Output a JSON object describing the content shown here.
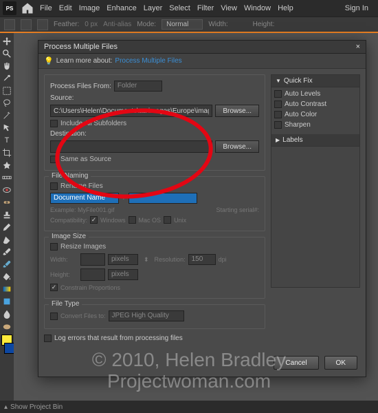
{
  "menubar": {
    "items": [
      "File",
      "Edit",
      "Image",
      "Enhance",
      "Layer",
      "Select",
      "Filter",
      "View",
      "Window",
      "Help"
    ],
    "signin": "Sign In"
  },
  "optionsbar": {
    "feather": "Feather:",
    "feather_val": "0 px",
    "antialias": "Anti-alias",
    "mode": "Mode:",
    "mode_val": "Normal",
    "width": "Width:",
    "height": "Height:"
  },
  "dialog": {
    "title": "Process Multiple Files",
    "learn_more": "Learn more about:",
    "learn_link": "Process Multiple Files",
    "process_from": "Process Files From:",
    "process_from_val": "Folder",
    "source": "Source:",
    "source_val": "C:\\Users\\Helen\\Documents\\aa images\\Europe\\images fo",
    "browse": "Browse...",
    "include_sub": "Include All Subfolders",
    "destination": "Destination:",
    "same_as": "Same as Source",
    "file_naming": "File Naming",
    "rename": "Rename Files",
    "token1": "Document Name",
    "example": "Example: MyFile001.gif",
    "starting": "Starting serial#:",
    "compat": "Compatibility:",
    "compat_win": "Windows",
    "compat_mac": "Mac OS",
    "compat_unix": "Unix",
    "image_size": "Image Size",
    "resize": "Resize Images",
    "width_l": "Width:",
    "height_l": "Height:",
    "pixels": "pixels",
    "res": "Resolution:",
    "res_val": "150",
    "dpi": "dpi",
    "constrain": "Constrain Proportions",
    "file_type": "File Type",
    "convert": "Convert Files to:",
    "convert_val": "JPEG High Quality",
    "log_errors": "Log errors that result from processing files",
    "cancel": "Cancel",
    "ok": "OK",
    "quickfix": "Quick Fix",
    "qf": [
      "Auto Levels",
      "Auto Contrast",
      "Auto Color",
      "Sharpen"
    ],
    "labels": "Labels"
  },
  "statusbar": {
    "text": "Show Project Bin"
  },
  "watermark": {
    "l1": "© 2010, Helen Bradley",
    "l2": "Projectwoman.com"
  }
}
